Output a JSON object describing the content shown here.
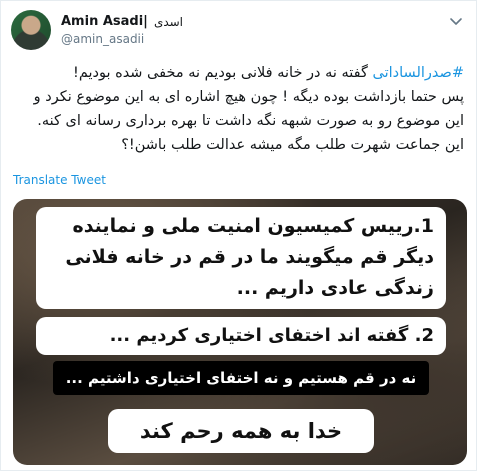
{
  "author": {
    "display_name": "Amin Asadi|",
    "display_name_fa": "اسدی",
    "handle": "@amin_asadii"
  },
  "tweet": {
    "hashtag": "#صدرالساداتی",
    "line1_rest": " گفته نه در خانه فلانی بودیم نه مخفی شده بودیم!",
    "line2": "پس حتما بازداشت بوده دیگه ! چون هیچ اشاره ای به این موضوع نکرد و",
    "line3": "این موضوع رو به صورت شبهه نگه داشت تا بهره برداری رسانه ای کنه.",
    "line4": "این جماعت شهرت طلب مگه میشه عدالت طلب باشن!؟"
  },
  "translate_label": "Translate Tweet",
  "media": {
    "card1": "1.رییس کمیسیون امنیت ملی و نماینده دیگر قم میگویند ما در قم در خانه فلانی زندگی عادی داریم ...",
    "card2": "2. گفته اند اختفای اختیاری کردیم ...",
    "card3": "نه در قم هستیم و نه اختفای اختیاری داشتیم ...",
    "card4": "خدا به همه رحم کند"
  },
  "icons": {
    "more": "chevron-down-icon"
  },
  "colors": {
    "link": "#1b95e0",
    "secondary": "#657786"
  }
}
